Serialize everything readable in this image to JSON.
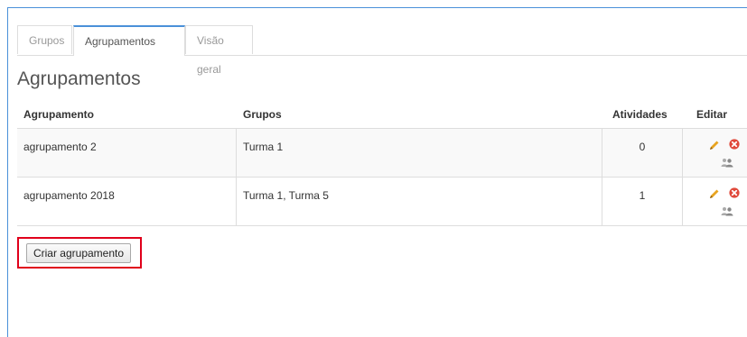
{
  "tabs": [
    {
      "label": "Grupos",
      "active": false
    },
    {
      "label": "Agrupamentos",
      "active": true
    },
    {
      "label": "Visão geral",
      "active": false
    }
  ],
  "page_title": "Agrupamentos",
  "table": {
    "headers": [
      "Agrupamento",
      "Grupos",
      "Atividades",
      "Editar"
    ],
    "rows": [
      {
        "agrupamento": "agrupamento 2",
        "grupos": "Turma 1",
        "atividades": "0"
      },
      {
        "agrupamento": "agrupamento 2018",
        "grupos": "Turma 1, Turma 5",
        "atividades": "1"
      }
    ],
    "row_icons": [
      "pencil-icon",
      "delete-icon",
      "users-icon"
    ]
  },
  "create_button": "Criar agrupamento",
  "colors": {
    "accent": "#4a90d9",
    "highlight": "#e0001b",
    "pencil": "#e8a420",
    "delete": "#e0493b",
    "users": "#999999"
  }
}
